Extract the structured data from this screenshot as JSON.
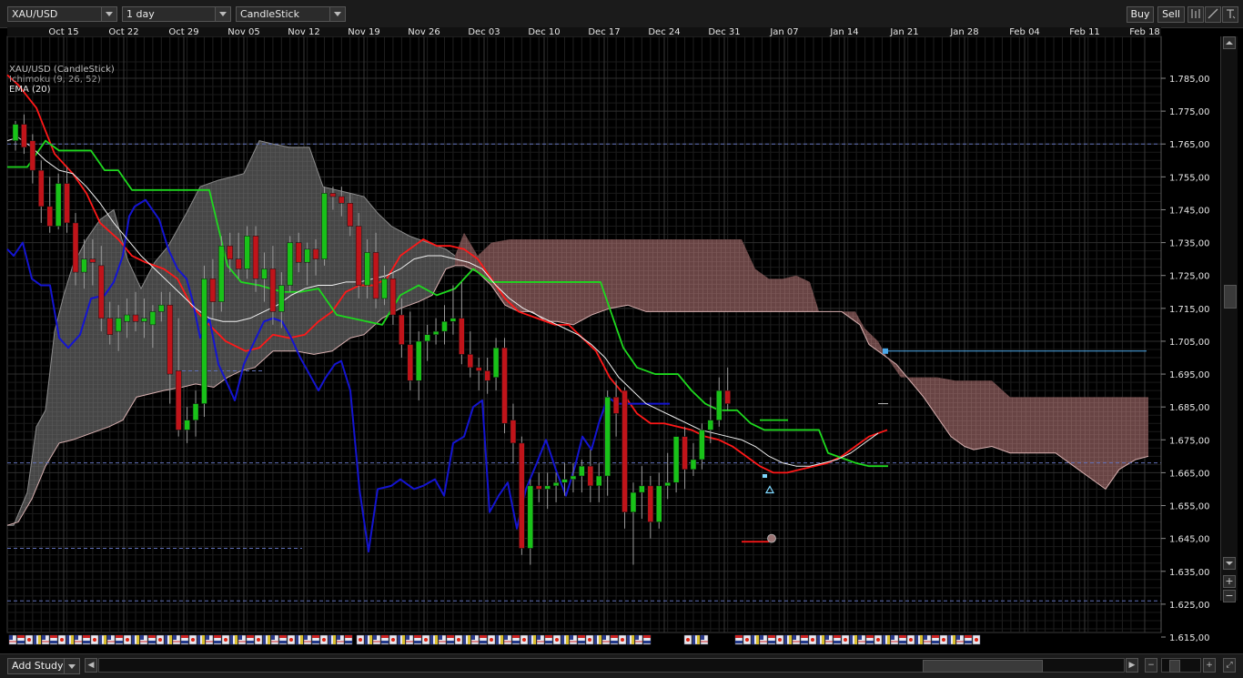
{
  "toolbar": {
    "symbol": "XAU/USD",
    "interval": "1 day",
    "chart_style": "CandleStick",
    "buy_label": "Buy",
    "sell_label": "Sell"
  },
  "legend": {
    "line1": "XAU/USD (CandleStick)",
    "line2": "Ichimoku (9, 26, 52)",
    "line3": "EMA (20)"
  },
  "bottom": {
    "add_study_label": "Add Study"
  },
  "colors": {
    "background": "#000000",
    "grid": "#2a2a2a",
    "bull": "#19c219",
    "bear": "#c0141a",
    "tenkan": "#ff1818",
    "kijun": "#1ed81e",
    "chikou": "#1414d0",
    "ema": "#f0f0f0",
    "cloud_gray": "#6e6e6e",
    "cloud_red": "#b89090",
    "dashed": "#5f6fb8"
  },
  "chart_data": {
    "type": "candlestick",
    "x_ticks": [
      "Oct 15",
      "Oct 22",
      "Oct 29",
      "Nov 05",
      "Nov 12",
      "Nov 19",
      "Nov 26",
      "Dec 03",
      "Dec 10",
      "Dec 17",
      "Dec 24",
      "Dec 31",
      "Jan 07",
      "Jan 14",
      "Jan 21",
      "Jan 28",
      "Feb 04",
      "Feb 11",
      "Feb 18"
    ],
    "y_ticks": [
      "1.785,00",
      "1.775,00",
      "1.765,00",
      "1.755,00",
      "1.745,00",
      "1.735,00",
      "1.725,00",
      "1.715,00",
      "1.705,00",
      "1.695,00",
      "1.685,00",
      "1.675,00",
      "1.665,00",
      "1.655,00",
      "1.645,00",
      "1.635,00",
      "1.625,00",
      "1.615,00"
    ],
    "ylim": [
      1612,
      1792
    ],
    "candles": [
      [
        1766,
        1772,
        1763,
        1771
      ],
      [
        1771,
        1774,
        1762,
        1764
      ],
      [
        1766,
        1768,
        1753,
        1757
      ],
      [
        1757,
        1760,
        1741,
        1746
      ],
      [
        1746,
        1755,
        1738,
        1740
      ],
      [
        1740,
        1756,
        1739,
        1753
      ],
      [
        1753,
        1758,
        1738,
        1741
      ],
      [
        1741,
        1744,
        1722,
        1726
      ],
      [
        1726,
        1736,
        1721,
        1730
      ],
      [
        1730,
        1736,
        1722,
        1729
      ],
      [
        1728,
        1734,
        1708,
        1712
      ],
      [
        1712,
        1717,
        1704,
        1707
      ],
      [
        1708,
        1716,
        1702,
        1712
      ],
      [
        1711,
        1718,
        1706,
        1713
      ],
      [
        1713,
        1720,
        1708,
        1711
      ],
      [
        1711,
        1718,
        1706,
        1712
      ],
      [
        1710,
        1716,
        1703,
        1714
      ],
      [
        1714,
        1720,
        1711,
        1716
      ],
      [
        1716,
        1720,
        1686,
        1695
      ],
      [
        1696,
        1712,
        1676,
        1678
      ],
      [
        1678,
        1685,
        1674,
        1681
      ],
      [
        1681,
        1690,
        1676,
        1686
      ],
      [
        1686,
        1728,
        1682,
        1724
      ],
      [
        1724,
        1730,
        1712,
        1717
      ],
      [
        1717,
        1737,
        1714,
        1734
      ],
      [
        1734,
        1738,
        1726,
        1730
      ],
      [
        1730,
        1738,
        1724,
        1727
      ],
      [
        1727,
        1740,
        1724,
        1737
      ],
      [
        1737,
        1740,
        1720,
        1724
      ],
      [
        1724,
        1732,
        1717,
        1727
      ],
      [
        1727,
        1734,
        1710,
        1714
      ],
      [
        1714,
        1726,
        1709,
        1722
      ],
      [
        1722,
        1737,
        1720,
        1735
      ],
      [
        1735,
        1738,
        1726,
        1729
      ],
      [
        1729,
        1735,
        1722,
        1733
      ],
      [
        1733,
        1736,
        1725,
        1730
      ],
      [
        1730,
        1752,
        1728,
        1750
      ],
      [
        1750,
        1752,
        1745,
        1749
      ],
      [
        1749,
        1752,
        1743,
        1747
      ],
      [
        1747,
        1750,
        1737,
        1740
      ],
      [
        1740,
        1744,
        1718,
        1722
      ],
      [
        1722,
        1736,
        1718,
        1732
      ],
      [
        1732,
        1738,
        1715,
        1718
      ],
      [
        1718,
        1728,
        1716,
        1724
      ],
      [
        1724,
        1726,
        1710,
        1713
      ],
      [
        1713,
        1718,
        1700,
        1704
      ],
      [
        1704,
        1714,
        1690,
        1693
      ],
      [
        1693,
        1708,
        1687,
        1705
      ],
      [
        1705,
        1710,
        1699,
        1707
      ],
      [
        1707,
        1712,
        1704,
        1708
      ],
      [
        1708,
        1716,
        1704,
        1711
      ],
      [
        1711,
        1722,
        1707,
        1712
      ],
      [
        1712,
        1723,
        1698,
        1701
      ],
      [
        1701,
        1708,
        1694,
        1697
      ],
      [
        1697,
        1700,
        1690,
        1696
      ],
      [
        1696,
        1700,
        1689,
        1693
      ],
      [
        1694,
        1706,
        1690,
        1703
      ],
      [
        1703,
        1706,
        1677,
        1680
      ],
      [
        1681,
        1686,
        1668,
        1674
      ],
      [
        1674,
        1676,
        1640,
        1642
      ],
      [
        1642,
        1663,
        1637,
        1661
      ],
      [
        1661,
        1665,
        1656,
        1660
      ],
      [
        1660,
        1665,
        1654,
        1661
      ],
      [
        1661,
        1665,
        1656,
        1662
      ],
      [
        1662,
        1668,
        1658,
        1663
      ],
      [
        1663,
        1668,
        1659,
        1664
      ],
      [
        1664,
        1669,
        1659,
        1667
      ],
      [
        1667,
        1672,
        1656,
        1661
      ],
      [
        1661,
        1668,
        1656,
        1664
      ],
      [
        1664,
        1690,
        1658,
        1688
      ],
      [
        1688,
        1693,
        1676,
        1683
      ],
      [
        1690,
        1691,
        1648,
        1653
      ],
      [
        1653,
        1662,
        1637,
        1659
      ],
      [
        1659,
        1667,
        1651,
        1661
      ],
      [
        1661,
        1664,
        1645,
        1650
      ],
      [
        1650,
        1665,
        1648,
        1661
      ],
      [
        1661,
        1671,
        1657,
        1662
      ],
      [
        1662,
        1672,
        1659,
        1676
      ],
      [
        1676,
        1679,
        1660,
        1666
      ],
      [
        1666,
        1674,
        1664,
        1669
      ],
      [
        1669,
        1680,
        1666,
        1678
      ],
      [
        1678,
        1688,
        1674,
        1681
      ],
      [
        1681,
        1694,
        1679,
        1690
      ],
      [
        1690,
        1697,
        1684,
        1686
      ]
    ]
  }
}
